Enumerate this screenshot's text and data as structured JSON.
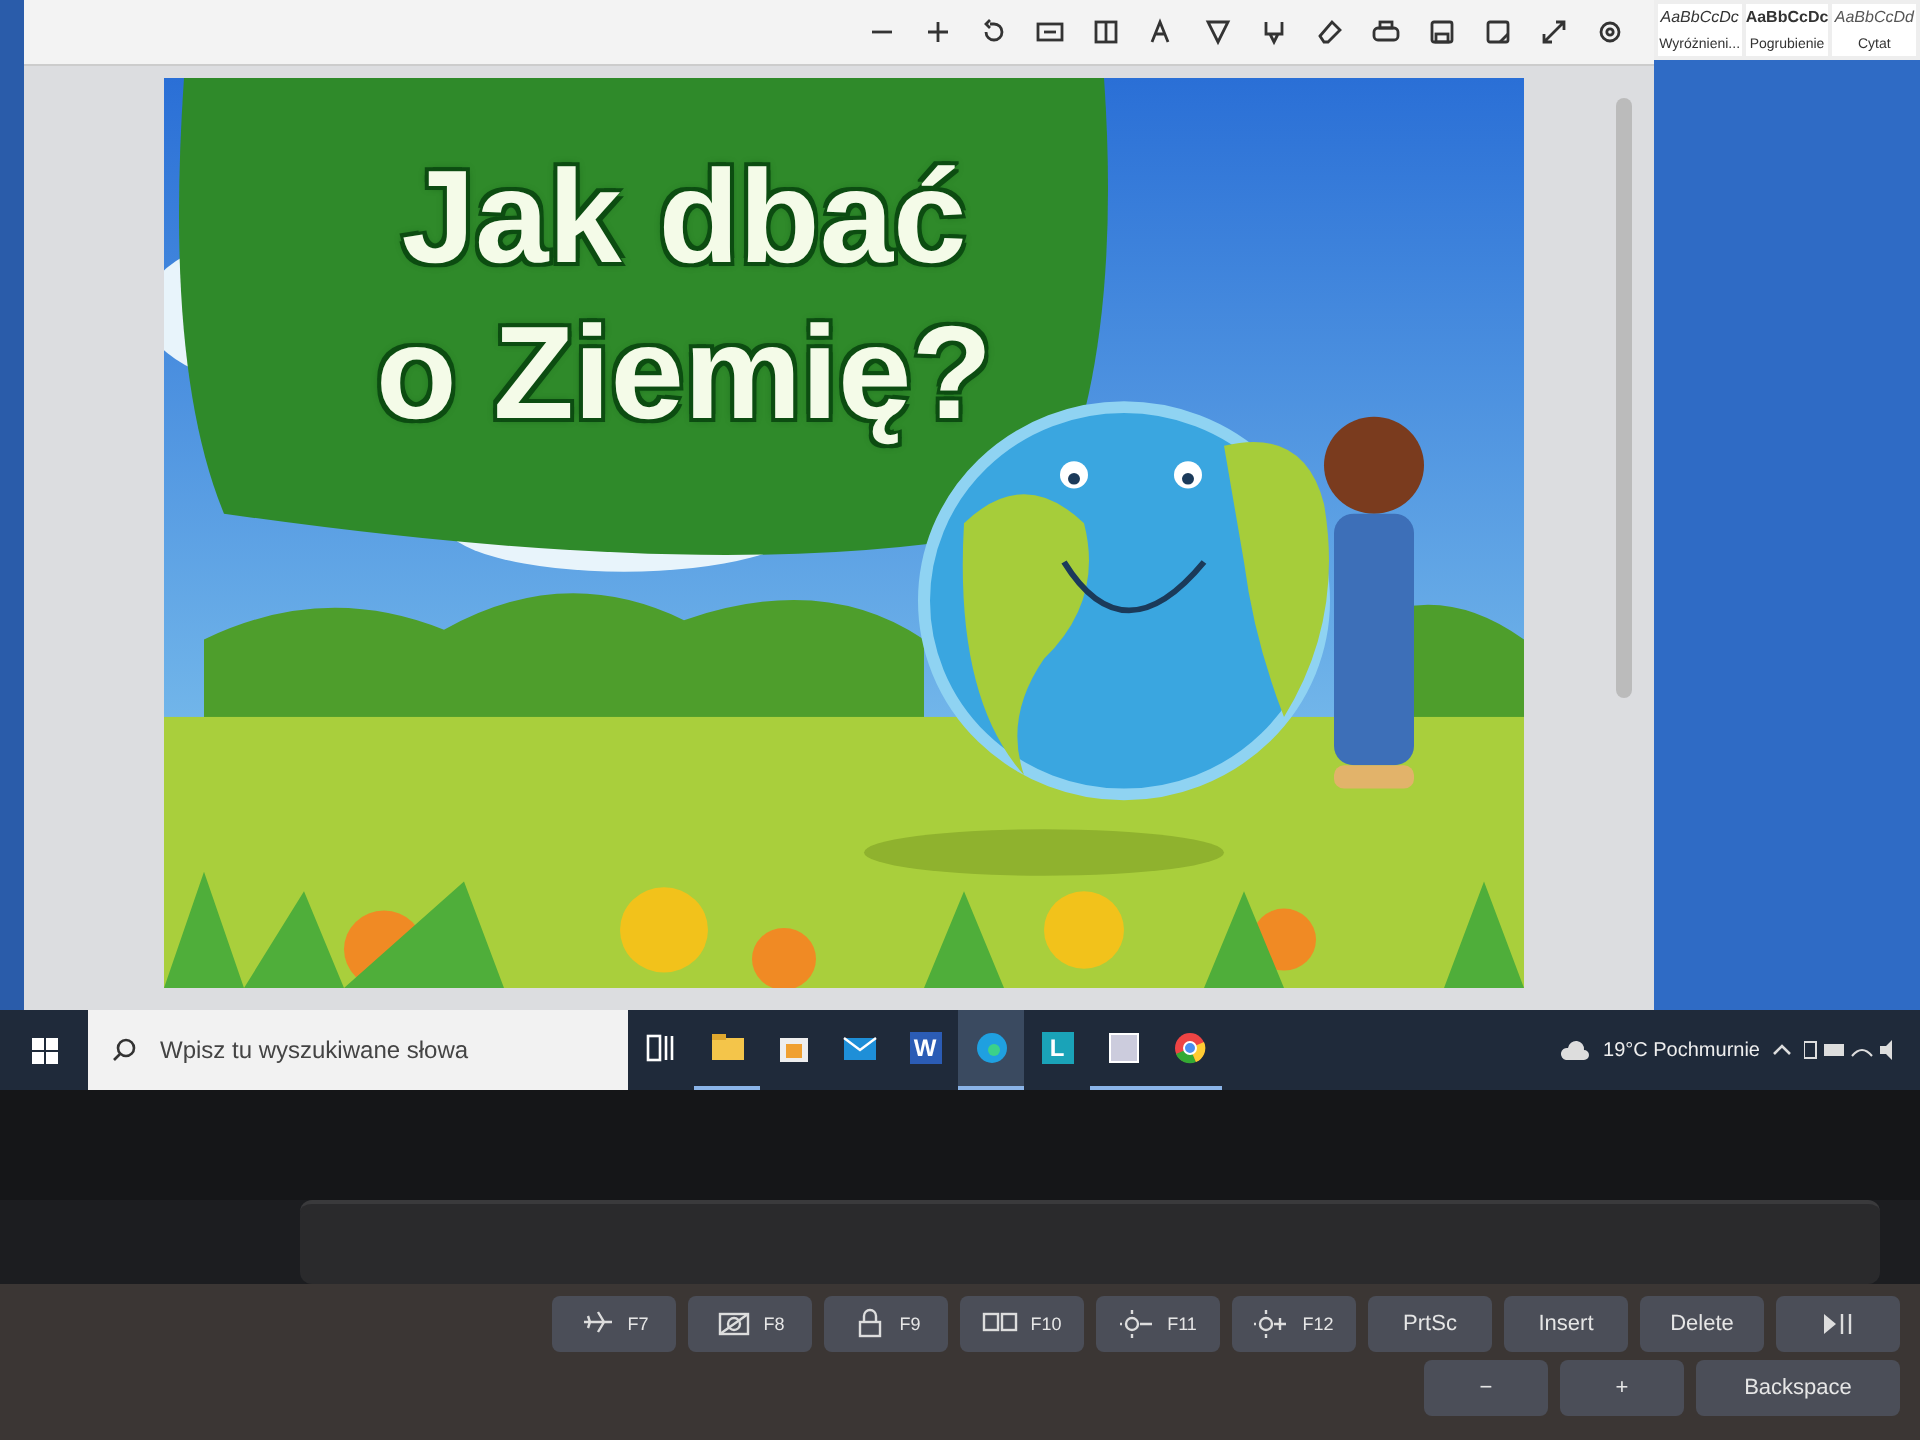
{
  "document": {
    "title": "Jak dbać o Ziemię?"
  },
  "word_styles": [
    {
      "sample": "AaBbCcDc",
      "name": "Wyróżnieni...",
      "kind": "emphasis"
    },
    {
      "sample": "AaBbCcDc",
      "name": "Pogrubienie",
      "kind": "strong"
    },
    {
      "sample": "AaBbCcDd",
      "name": "Cytat",
      "kind": "quote"
    }
  ],
  "taskbar": {
    "search": {
      "placeholder": "Wpisz tu wyszukiwane słowa"
    },
    "apps": [
      {
        "kind": "task-view",
        "running": false,
        "selected": false
      },
      {
        "kind": "folder",
        "running": true,
        "selected": false
      },
      {
        "kind": "store",
        "running": false,
        "selected": false
      },
      {
        "kind": "mail",
        "running": false,
        "selected": false
      },
      {
        "kind": "word",
        "label": "W",
        "running": false,
        "selected": false
      },
      {
        "kind": "edge",
        "running": true,
        "selected": true
      },
      {
        "kind": "letter",
        "label": "L",
        "running": false,
        "selected": false
      },
      {
        "kind": "app",
        "running": true,
        "selected": false
      },
      {
        "kind": "chrome",
        "running": true,
        "selected": false
      }
    ],
    "weather": "19°C Pochmurnie"
  },
  "keyboard": {
    "rows": [
      [
        {
          "kind": "airplane",
          "label": "F7"
        },
        {
          "kind": "camera",
          "label": "F8"
        },
        {
          "kind": "lock",
          "label": "F9"
        },
        {
          "kind": "display",
          "label": "F10"
        },
        {
          "kind": "brightness-down",
          "label": "F11"
        },
        {
          "kind": "brightness-up",
          "label": "F12"
        },
        {
          "kind": "text",
          "label": "PrtSc"
        },
        {
          "kind": "text",
          "label": "Insert"
        },
        {
          "kind": "text",
          "label": "Delete"
        },
        {
          "kind": "play-pause"
        }
      ],
      [
        {
          "kind": "text",
          "label": "−"
        },
        {
          "kind": "text",
          "label": "+"
        },
        {
          "kind": "wide",
          "label": "Backspace"
        }
      ]
    ]
  }
}
